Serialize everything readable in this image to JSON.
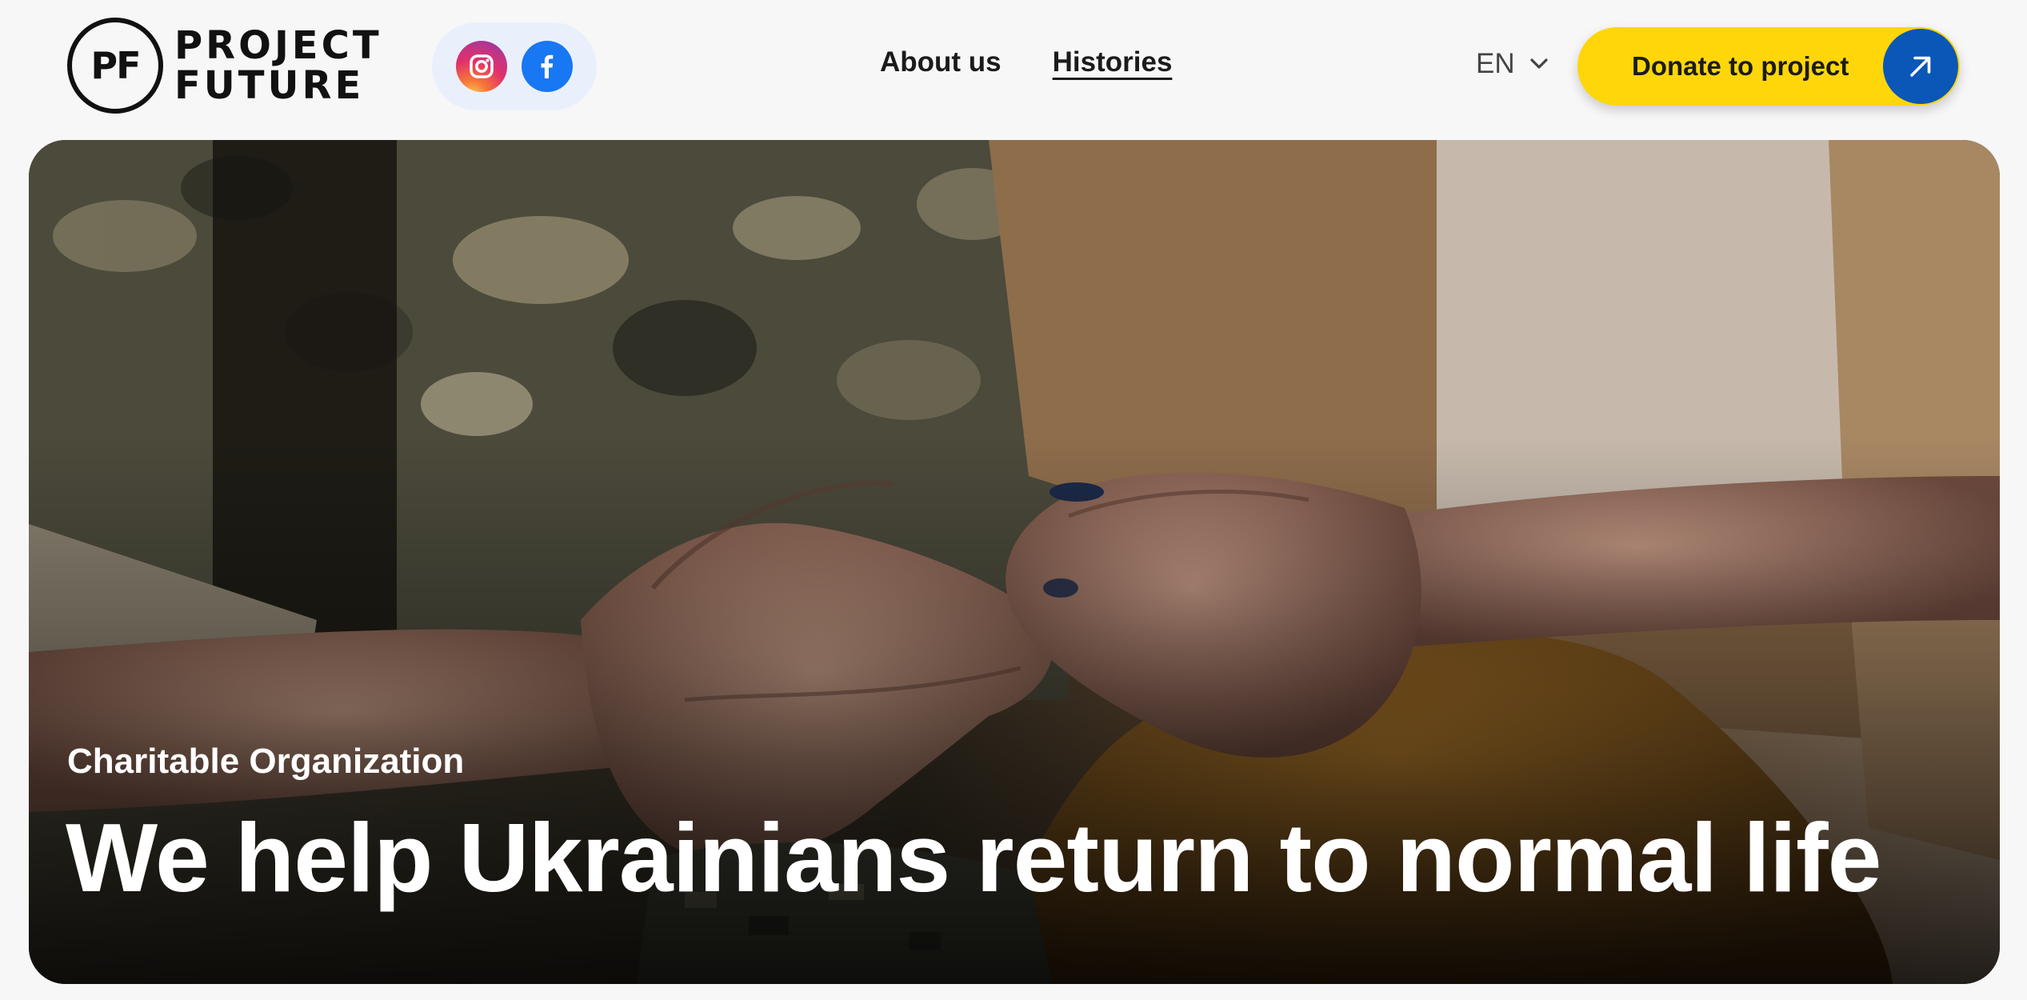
{
  "header": {
    "logo": {
      "mark": "PF",
      "line1": "PROJECT",
      "line2": "FUTURE"
    },
    "socials": [
      {
        "name": "Instagram",
        "icon": "instagram-icon"
      },
      {
        "name": "Facebook",
        "icon": "facebook-icon"
      }
    ],
    "nav": {
      "about": "About us",
      "histories": "Histories",
      "active": "Histories"
    },
    "language": {
      "selected": "EN",
      "icon": "chevron-down-icon"
    },
    "donate": {
      "label": "Donate to project",
      "icon": "arrow-up-right-icon"
    }
  },
  "hero": {
    "subtitle": "Charitable Organization",
    "title": "We help Ukrainians return to normal life"
  },
  "colors": {
    "page_bg": "#f7f7f8",
    "donate_yellow": "#ffd60a",
    "donate_arrow_blue": "#0a57b8",
    "socials_bg": "#eaf0fb",
    "facebook_blue": "#1877f2",
    "hero_text": "#ffffff"
  }
}
